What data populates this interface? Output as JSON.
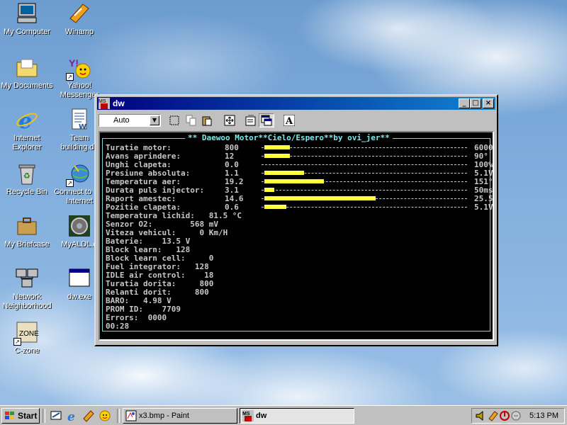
{
  "desktop": {
    "icons": [
      {
        "label": "My Computer",
        "icon": "my-computer-icon"
      },
      {
        "label": "Winamp",
        "icon": "winamp-icon"
      },
      {
        "label": "My Documents",
        "icon": "my-documents-icon"
      },
      {
        "label": "Yahoo! Messenger",
        "icon": "yahoo-messenger-icon"
      },
      {
        "label": "Internet Explorer",
        "icon": "internet-explorer-icon"
      },
      {
        "label": "Team building.do",
        "icon": "word-document-icon"
      },
      {
        "label": "Recycle Bin",
        "icon": "recycle-bin-icon"
      },
      {
        "label": "Connect to the Internet",
        "icon": "connect-internet-icon"
      },
      {
        "label": "My Briefcase",
        "icon": "briefcase-icon"
      },
      {
        "label": "MyALDL.e",
        "icon": "myaldl-icon"
      },
      {
        "label": "Network Neighborhood",
        "icon": "network-icon"
      },
      {
        "label": "dw.exe",
        "icon": "dw-exe-icon"
      },
      {
        "label": "C-zone",
        "icon": "czone-icon"
      }
    ]
  },
  "window": {
    "title": "dw",
    "toolbar": {
      "font_combo_value": "Auto"
    },
    "console": {
      "header": "** Daewoo Motor**Cielo/Espero**by ovi_jer**",
      "gauges": [
        {
          "label": "Turatie motor:",
          "value": "800",
          "max": "6000",
          "level": 0.13
        },
        {
          "label": "Avans aprindere:",
          "value": "12",
          "max": "90°",
          "level": 0.13
        },
        {
          "label": "Unghi clapeta:",
          "value": "0.0",
          "max": "100%",
          "level": 0.0
        },
        {
          "label": "Presiune absoluta:",
          "value": "1.1",
          "max": "5.1V",
          "level": 0.2
        },
        {
          "label": "Temperatura aer:",
          "value": "19.2",
          "max": "151°C",
          "level": 0.3
        },
        {
          "label": "Durata puls injector:",
          "value": "3.1",
          "max": "50ms",
          "level": 0.05
        },
        {
          "label": "Raport amestec:",
          "value": "14.6",
          "max": "25.5",
          "level": 0.56
        },
        {
          "label": "Pozitie clapeta:",
          "value": "0.6",
          "max": "5.1V",
          "level": 0.11
        }
      ],
      "lines": [
        "Temperatura lichid:   81.5 °C",
        "Senzor O2:        568 mV",
        "Viteza vehicul:     0 Km/H",
        "Baterie:    13.5 V",
        "Block learn:   128",
        "Block learn cell:     0",
        "Fuel integrator:   128",
        "IDLE air control:    18",
        "Turatia dorita:     800",
        "Relanti dorit:     800",
        "BARO:   4.98 V",
        "PROM ID:    7709",
        "Errors:  0000",
        "00:28"
      ]
    }
  },
  "taskbar": {
    "start_label": "Start",
    "tasks": [
      {
        "label": "x3.bmp - Paint",
        "active": false
      },
      {
        "label": "dw",
        "active": true
      }
    ],
    "clock": "5:13 PM"
  },
  "colors": {
    "console_bg": "#000000",
    "console_text": "#c8c8c8",
    "gauge_fill": "#ffff40",
    "frame_cyan": "#7fd8d8",
    "title_active": "#000080"
  }
}
